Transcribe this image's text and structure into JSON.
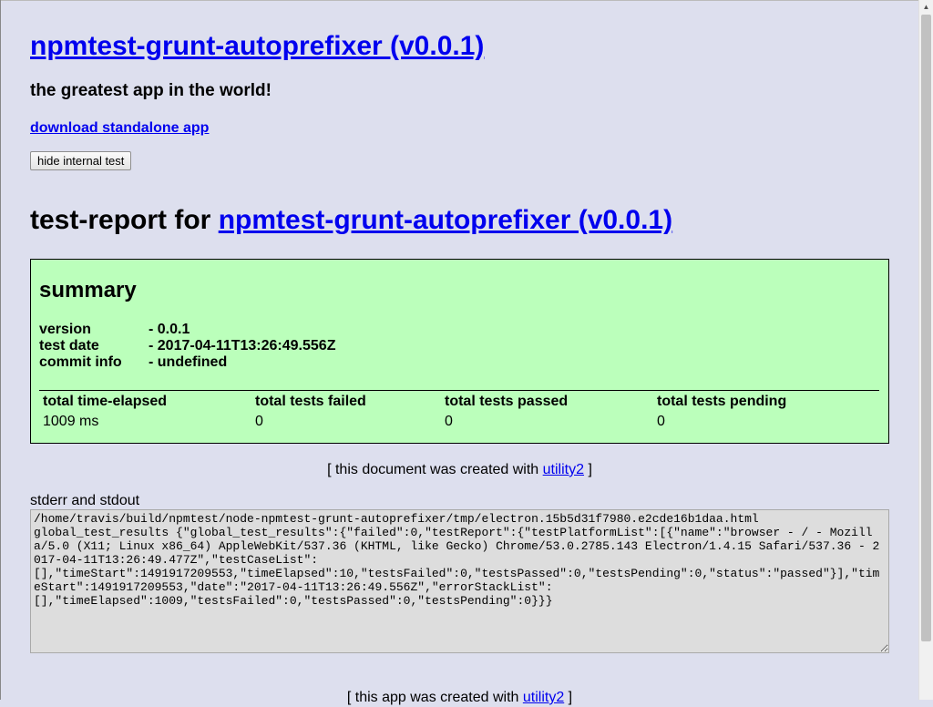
{
  "app": {
    "title": "npmtest-grunt-autoprefixer (v0.0.1)",
    "tagline": "the greatest app in the world!",
    "download_link": "download standalone app",
    "hide_button": "hide internal test"
  },
  "report": {
    "title_prefix": "test-report for ",
    "title_link": "npmtest-grunt-autoprefixer (v0.0.1)"
  },
  "summary": {
    "heading": "summary",
    "fields": [
      {
        "key": "version",
        "value": "- 0.0.1"
      },
      {
        "key": "test date",
        "value": "- 2017-04-11T13:26:49.556Z"
      },
      {
        "key": "commit info",
        "value": "- undefined"
      }
    ],
    "totals": [
      {
        "label": "total time-elapsed",
        "value": "1009 ms"
      },
      {
        "label": "total tests failed",
        "value": "0"
      },
      {
        "label": "total tests passed",
        "value": "0"
      },
      {
        "label": "total tests pending",
        "value": "0"
      }
    ]
  },
  "created_note": {
    "prefix": "[ this document was created with ",
    "link": "utility2",
    "suffix": " ]"
  },
  "stdout": {
    "label": "stderr and stdout",
    "content": "/home/travis/build/npmtest/node-npmtest-grunt-autoprefixer/tmp/electron.15b5d31f7980.e2cde16b1daa.html\nglobal_test_results {\"global_test_results\":{\"failed\":0,\"testReport\":{\"testPlatformList\":[{\"name\":\"browser - / - Mozilla/5.0 (X11; Linux x86_64) AppleWebKit/537.36 (KHTML, like Gecko) Chrome/53.0.2785.143 Electron/1.4.15 Safari/537.36 - 2017-04-11T13:26:49.477Z\",\"testCaseList\":\n[],\"timeStart\":1491917209553,\"timeElapsed\":10,\"testsFailed\":0,\"testsPassed\":0,\"testsPending\":0,\"status\":\"passed\"}],\"timeStart\":1491917209553,\"date\":\"2017-04-11T13:26:49.556Z\",\"errorStackList\":\n[],\"timeElapsed\":1009,\"testsFailed\":0,\"testsPassed\":0,\"testsPending\":0}}}"
  },
  "app_note": {
    "prefix": "[ this app was created with ",
    "link": "utility2",
    "suffix": " ]"
  },
  "colors": {
    "background": "#dddfee",
    "summary_background": "#bbffbb",
    "link": "#0000ee",
    "textarea_background": "#dddddd"
  }
}
